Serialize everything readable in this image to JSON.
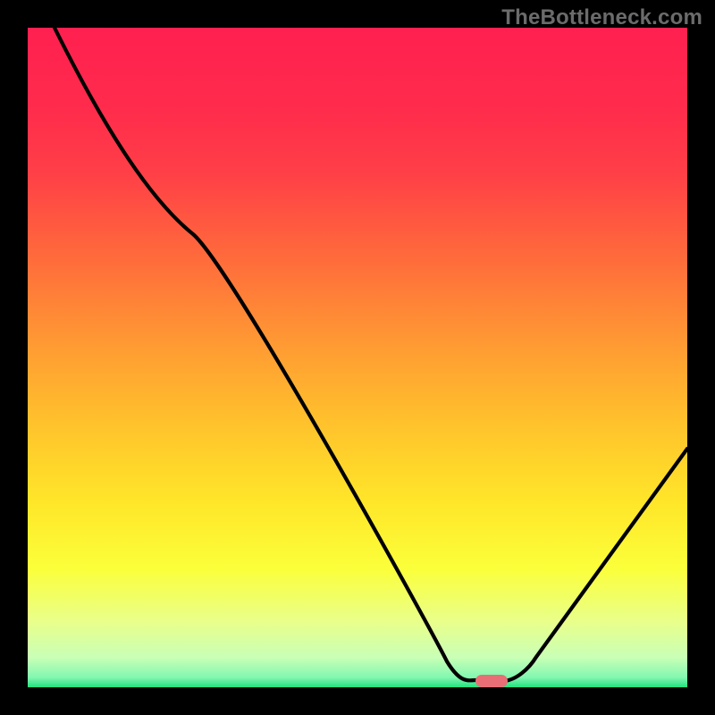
{
  "watermark": {
    "text": "TheBottleneck.com"
  },
  "marker": {
    "color": "#e76f75"
  },
  "chart_data": {
    "type": "line",
    "title": "",
    "xlabel": "",
    "ylabel": "",
    "xlim": [
      0,
      100
    ],
    "ylim": [
      0,
      100
    ],
    "grid": false,
    "series": [
      {
        "name": "bottleneck-curve",
        "values": [
          {
            "x": 4,
            "y": 100
          },
          {
            "x": 20,
            "y": 73
          },
          {
            "x": 25,
            "y": 66
          },
          {
            "x": 63,
            "y": 3
          },
          {
            "x": 67,
            "y": 1
          },
          {
            "x": 72,
            "y": 1
          },
          {
            "x": 77,
            "y": 5
          },
          {
            "x": 100,
            "y": 36
          }
        ]
      }
    ],
    "annotations": [
      {
        "name": "min-marker",
        "x": 70,
        "y": 1
      }
    ],
    "background_gradient_stops": [
      {
        "t": 0.0,
        "color": "#ff2050"
      },
      {
        "t": 0.12,
        "color": "#ff2b4c"
      },
      {
        "t": 0.22,
        "color": "#ff3f47"
      },
      {
        "t": 0.35,
        "color": "#ff6b3b"
      },
      {
        "t": 0.48,
        "color": "#ff9a33"
      },
      {
        "t": 0.6,
        "color": "#ffc22c"
      },
      {
        "t": 0.72,
        "color": "#ffe629"
      },
      {
        "t": 0.82,
        "color": "#fbff3a"
      },
      {
        "t": 0.9,
        "color": "#e9ff8a"
      },
      {
        "t": 0.955,
        "color": "#c9ffb6"
      },
      {
        "t": 0.985,
        "color": "#83f7b0"
      },
      {
        "t": 1.0,
        "color": "#21e27f"
      }
    ]
  }
}
